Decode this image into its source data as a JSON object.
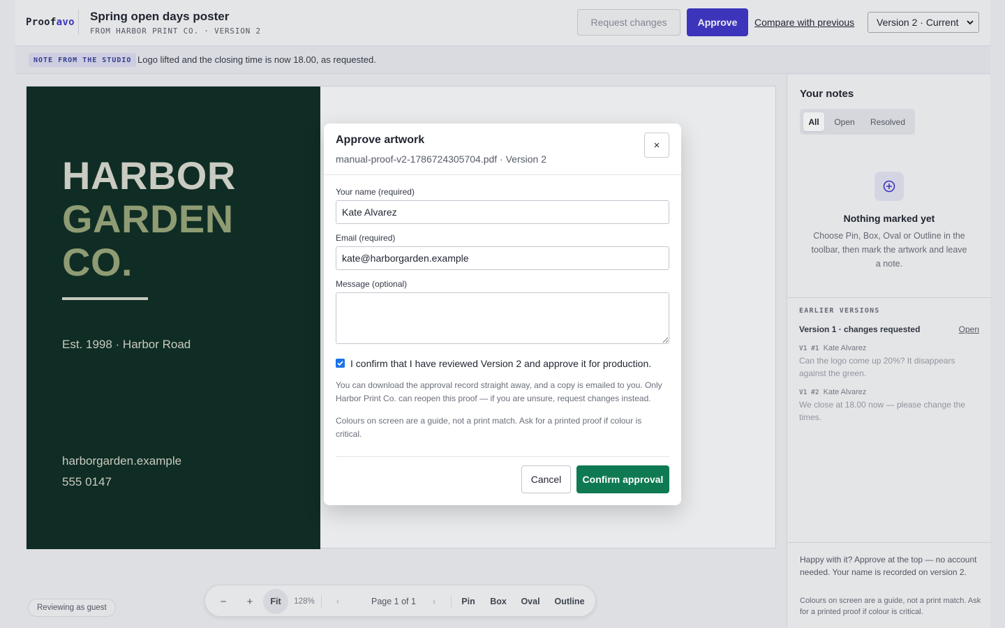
{
  "header": {
    "brand_prefix": "Proof",
    "brand_suffix": "avo",
    "title": "Spring open days poster",
    "subtitle": "FROM HARBOR PRINT CO. · VERSION 2",
    "request_changes_label": "Request changes",
    "approve_label": "Approve",
    "compare_label": "Compare with previous",
    "version_select": "Version 2 · Current"
  },
  "note_bar": {
    "tag": "NOTE FROM THE STUDIO",
    "text": "Logo lifted and the closing time is now 18.00, as requested."
  },
  "poster": {
    "line1": "HARBOR",
    "line2": "GARDEN",
    "line3": "CO.",
    "established": "Est. 1998 · Harbor Road",
    "website": "harborgarden.example",
    "phone": "555 0147",
    "colors": {
      "background": "#0f2e24",
      "line1": "#d9d9d0",
      "accent": "#9aa57a"
    }
  },
  "panel": {
    "title": "Your notes",
    "filters": [
      {
        "label": "All",
        "active": true
      },
      {
        "label": "Open",
        "active": false
      },
      {
        "label": "Resolved",
        "active": false
      }
    ],
    "empty_icon": "plus-circle-icon",
    "empty_title": "Nothing marked yet",
    "empty_text": "Choose Pin, Box, Oval or Outline in the toolbar, then mark the artwork and leave a note.",
    "earlier_label": "EARLIER VERSIONS",
    "earlier_version": "Version 1 · changes requested",
    "earlier_open": "Open",
    "comments": [
      {
        "code": "V1 #1",
        "author": "Kate Alvarez",
        "text": "Can the logo come up 20%? It disappears against the green."
      },
      {
        "code": "V1 #2",
        "author": "Kate Alvarez",
        "text": "We close at 18.00 now — please change the times."
      }
    ],
    "footer_text": "Happy with it? Approve at the top — no account needed. Your name is recorded on version 2.",
    "footer_note": "Colours on screen are a guide, not a print match. Ask for a printed proof if colour is critical."
  },
  "bottom": {
    "guest_label": "Reviewing as guest",
    "zoom_out": "−",
    "zoom_in": "+",
    "fit": "Fit",
    "zoom_level": "128%",
    "prev_page": "‹",
    "page_label": "Page 1 of 1",
    "next_page": "›",
    "tools": [
      "Pin",
      "Box",
      "Oval",
      "Outline"
    ]
  },
  "modal": {
    "title": "Approve artwork",
    "subtitle": "manual-proof-v2-1786724305704.pdf · Version 2",
    "close": "×",
    "name_label": "Your name (required)",
    "name_value": "Kate Alvarez",
    "email_label": "Email (required)",
    "email_value": "kate@harborgarden.example",
    "message_label": "Message (optional)",
    "message_value": "",
    "confirm_checked": true,
    "confirm_label": "I confirm that I have reviewed Version 2 and approve it for production.",
    "info1": "You can download the approval record straight away, and a copy is emailed to you. Only Harbor Print Co. can reopen this proof — if you are unsure, request changes instead.",
    "info2": "Colours on screen are a guide, not a print match. Ask for a printed proof if colour is critical.",
    "cancel_label": "Cancel",
    "confirm_button": "Confirm approval"
  }
}
